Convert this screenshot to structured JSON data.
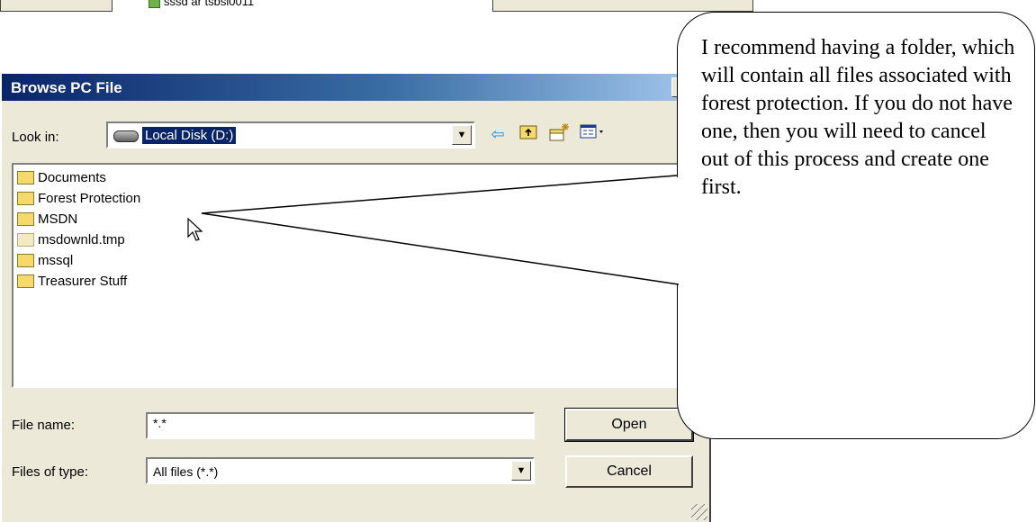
{
  "top_strip": {
    "label": "sssd ar tsbsl0011"
  },
  "dialog": {
    "title": "Browse PC File",
    "help_label": "?",
    "look_in_label": "Look in:",
    "look_in_value": "Local Disk (D:)",
    "toolbar": {
      "back_icon": "back-arrow-icon",
      "up_icon": "up-folder-icon",
      "new_folder_icon": "new-folder-icon",
      "view_icon": "view-menu-icon"
    },
    "files": [
      {
        "name": "Documents",
        "icon": "folder-icon"
      },
      {
        "name": "Forest Protection",
        "icon": "folder-icon"
      },
      {
        "name": "MSDN",
        "icon": "folder-icon"
      },
      {
        "name": "msdownld.tmp",
        "icon": "folder-icon"
      },
      {
        "name": "mssql",
        "icon": "folder-icon"
      },
      {
        "name": "Treasurer Stuff",
        "icon": "folder-icon"
      }
    ],
    "file_name_label": "File name:",
    "file_name_value": "*.*",
    "files_of_type_label": "Files of type:",
    "files_of_type_value": "All files (*.*)",
    "open_label": "Open",
    "cancel_label": "Cancel"
  },
  "callout": {
    "text": "I recommend having a folder, which will contain all files associated with forest protection.   If you do not have one, then you will need to cancel out of this process and create one first."
  }
}
